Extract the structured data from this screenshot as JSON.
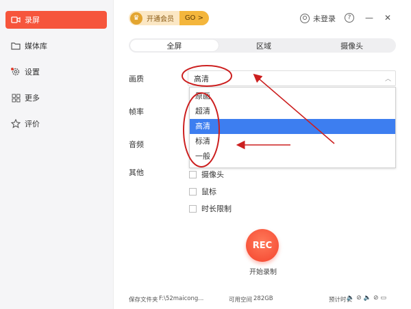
{
  "sidebar": {
    "items": [
      {
        "label": "录屏",
        "icon": "video-camera-icon"
      },
      {
        "label": "媒体库",
        "icon": "folder-icon"
      },
      {
        "label": "设置",
        "icon": "gear-icon"
      },
      {
        "label": "更多",
        "icon": "grid-icon"
      },
      {
        "label": "评价",
        "icon": "star-icon"
      }
    ]
  },
  "header": {
    "vip_label": "开通会员",
    "vip_go": "GO >",
    "login": "未登录",
    "help": "?",
    "minimize": "—",
    "close": "✕"
  },
  "tabs": [
    {
      "label": "全屏"
    },
    {
      "label": "区域"
    },
    {
      "label": "摄像头"
    }
  ],
  "settings": {
    "quality_label": "画质",
    "quality_value": "高清",
    "framerate_label": "帧率",
    "audio_label": "音频",
    "other_label": "其他",
    "quality_options": [
      "原画",
      "超清",
      "高清",
      "标清",
      "一般"
    ],
    "checkboxes": [
      {
        "label": "摄像头"
      },
      {
        "label": "鼠标"
      },
      {
        "label": "时长限制"
      }
    ]
  },
  "record": {
    "button": "REC",
    "caption": "开始录制"
  },
  "status": {
    "folder_label": "保存文件夹",
    "folder_path": "F:\\52maicong...",
    "space_label": "可用空间",
    "space_value": "282GB",
    "preview_label": "预计时长"
  },
  "colors": {
    "accent": "#f6553c",
    "selection": "#3d7ef0",
    "annotation": "#cc1f1f"
  }
}
